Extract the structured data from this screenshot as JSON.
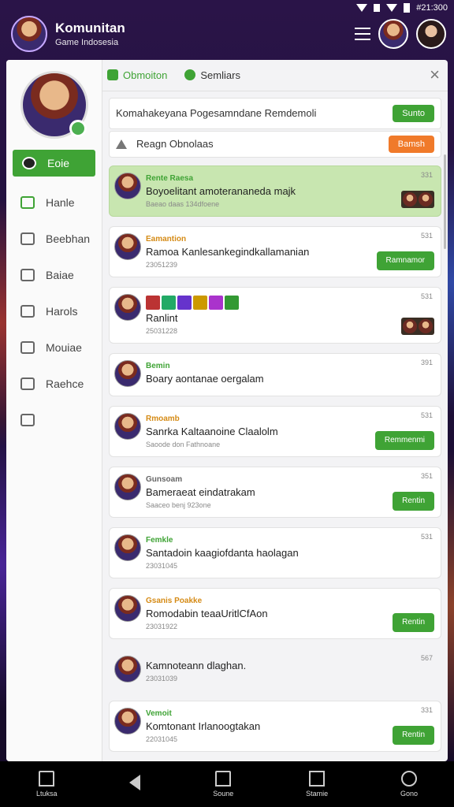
{
  "status": {
    "time": "#21:300"
  },
  "header": {
    "title": "Komunitan",
    "subtitle": "Game Indosesia"
  },
  "sidebar": {
    "items": [
      {
        "label": "Eoie",
        "icon": "user-icon",
        "active": true
      },
      {
        "label": "Hanle",
        "icon": "chat-icon"
      },
      {
        "label": "Beebhan",
        "icon": "grid-icon"
      },
      {
        "label": "Baiae",
        "icon": "group-icon"
      },
      {
        "label": "Harols",
        "icon": "flag-icon"
      },
      {
        "label": "Mouiae",
        "icon": "shield-icon"
      },
      {
        "label": "Raehce",
        "icon": "mail-icon"
      },
      {
        "label": "",
        "icon": "tag-icon"
      }
    ]
  },
  "tabs": [
    {
      "label": "Obmoiton",
      "active": true
    },
    {
      "label": "Semliars",
      "active": false
    }
  ],
  "top_cards": [
    {
      "text": "Komahakeyana Pogesamndane Remdemoli",
      "button": "Sunto",
      "button_color": "#3fa335"
    },
    {
      "text": "Reagn Obnolaas",
      "button": "Bamsh",
      "button_color": "#f07a2a"
    }
  ],
  "posts": [
    {
      "name": "Rente Raesa",
      "time": "331",
      "text": "Boyoelitant amoterananeda majk",
      "meta": "Baeao daas 134dfoene",
      "style": "highlight",
      "action": "thumbs"
    },
    {
      "name": "Eamantion",
      "time": "531",
      "text": "Ramoa Kanlesankegindkallamanian",
      "meta": "23051239",
      "style": "normal",
      "action": "Ramnamor"
    },
    {
      "name": "",
      "time": "531",
      "text": "Ranlint",
      "meta": "25031228",
      "style": "normal",
      "action": "thumbs",
      "game_icons": true
    },
    {
      "name": "Bemin",
      "time": "391",
      "text": "Boary aontanae oergalam",
      "meta": "",
      "style": "normal",
      "action": ""
    },
    {
      "name": "Rmoamb",
      "time": "531",
      "text": "Sanrka Kaltaanoine Claalolm",
      "meta": "Saoode don Fathnoane",
      "style": "normal",
      "action": "Remmenmi"
    },
    {
      "name": "Gunsoam",
      "time": "351",
      "text": "Bameraeat eindatrakam",
      "meta": "Saaceo benj 923one",
      "style": "normal",
      "action": "Rentin"
    },
    {
      "name": "Femkle",
      "time": "531",
      "text": "Santadoin kaagiofdanta haolagan",
      "meta": "23031045",
      "style": "normal",
      "action": ""
    },
    {
      "name": "Gsanis Poakke",
      "time": "",
      "text": "Romodabin teaaUritlCfAon",
      "meta": "23031922",
      "style": "normal",
      "action": "Rentin"
    },
    {
      "name": "",
      "time": "567",
      "text": "Kamnoteann dlaghan.",
      "meta": "23031039",
      "style": "plain",
      "action": ""
    },
    {
      "name": "Vemoit",
      "time": "331",
      "text": "Komtonant Irlanoogtakan",
      "meta": "22031045",
      "style": "normal",
      "action": "Rentin"
    }
  ],
  "bottom_nav": [
    {
      "label": "Ltuksa",
      "icon": "home-icon"
    },
    {
      "label": "",
      "icon": "back-icon"
    },
    {
      "label": "Soune",
      "icon": "home-outline-icon"
    },
    {
      "label": "Stamie",
      "icon": "square-icon"
    },
    {
      "label": "Gono",
      "icon": "circle-icon"
    }
  ]
}
